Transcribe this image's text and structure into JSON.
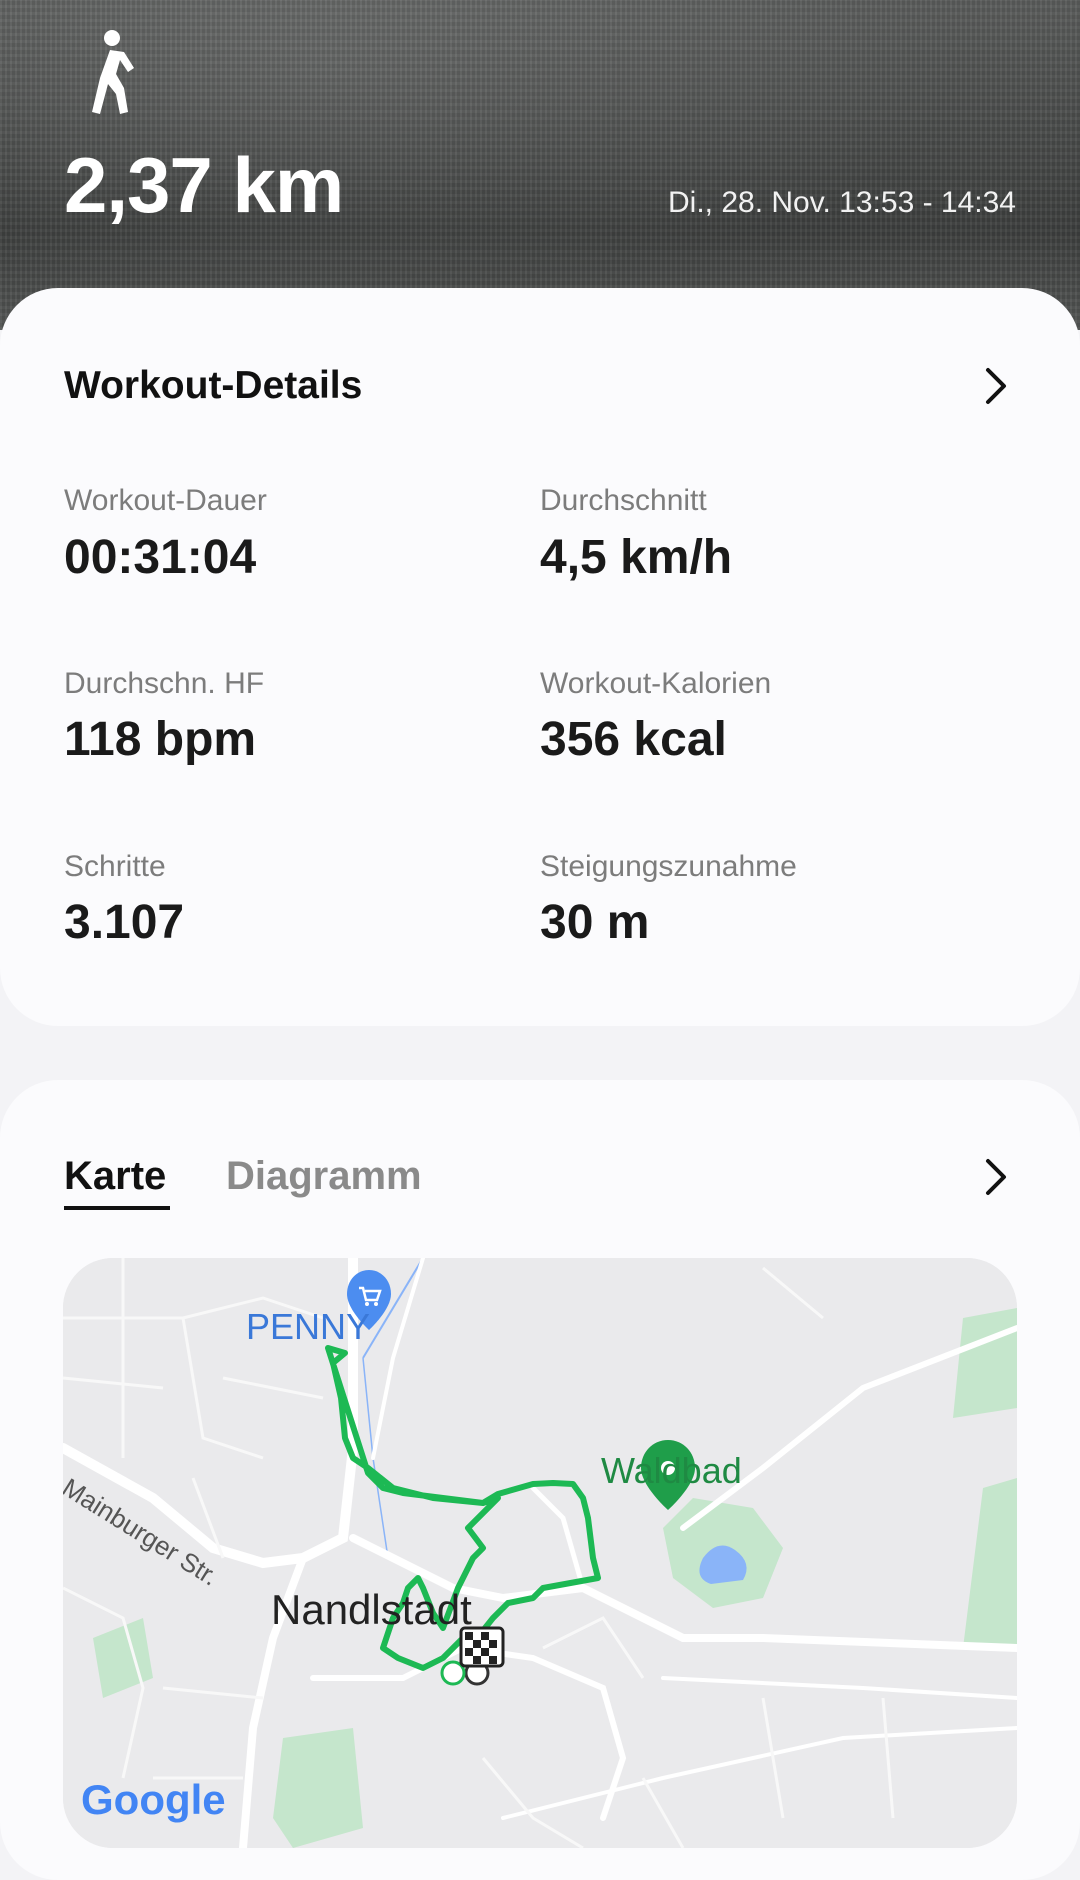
{
  "header": {
    "activity_icon": "walking-person-icon",
    "distance": "2,37 km",
    "date_range": "Di., 28. Nov. 13:53 - 14:34"
  },
  "details": {
    "title": "Workout-Details",
    "stats": [
      {
        "label": "Workout-Dauer",
        "value": "00:31:04"
      },
      {
        "label": "Durchschnitt",
        "value": "4,5 km/h"
      },
      {
        "label": "Durchschn. HF",
        "value": "118 bpm"
      },
      {
        "label": "Workout-Kalorien",
        "value": "356 kcal"
      },
      {
        "label": "Schritte",
        "value": "3.107"
      },
      {
        "label": "Steigungszunahme",
        "value": "30 m"
      }
    ]
  },
  "map_section": {
    "tabs": [
      "Karte",
      "Diagramm"
    ],
    "active_tab": "Karte",
    "labels": {
      "penny": "PENNY",
      "waldbad": "Waldbad",
      "street": "Mainburger Str.",
      "town": "Nandlstadt",
      "google": "Google"
    },
    "colors": {
      "route": "#1db954",
      "penny_pin": "#4c8df0",
      "waldbad_pin": "#1f9e4a",
      "park": "#c5e6cc",
      "water": "#8ab4f8"
    }
  }
}
